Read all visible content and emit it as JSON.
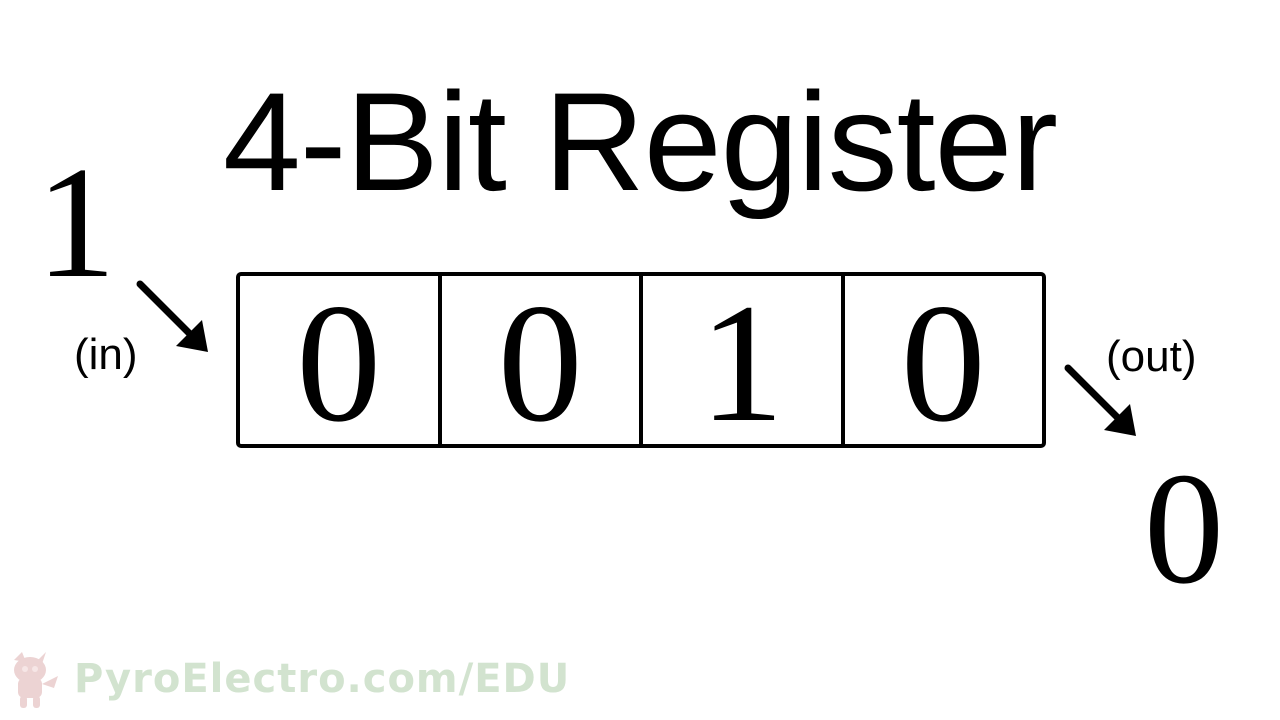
{
  "title": "4-Bit Register",
  "input": {
    "bit": "1",
    "label": "(in)"
  },
  "output": {
    "bit": "0",
    "label": "(out)"
  },
  "register": {
    "bits": [
      "0",
      "0",
      "1",
      "0"
    ]
  },
  "watermark": {
    "text": "PyroElectro.com/EDU",
    "color": "#d2e3cf",
    "logo_icon": "pyroelectro-mascot-logo"
  }
}
